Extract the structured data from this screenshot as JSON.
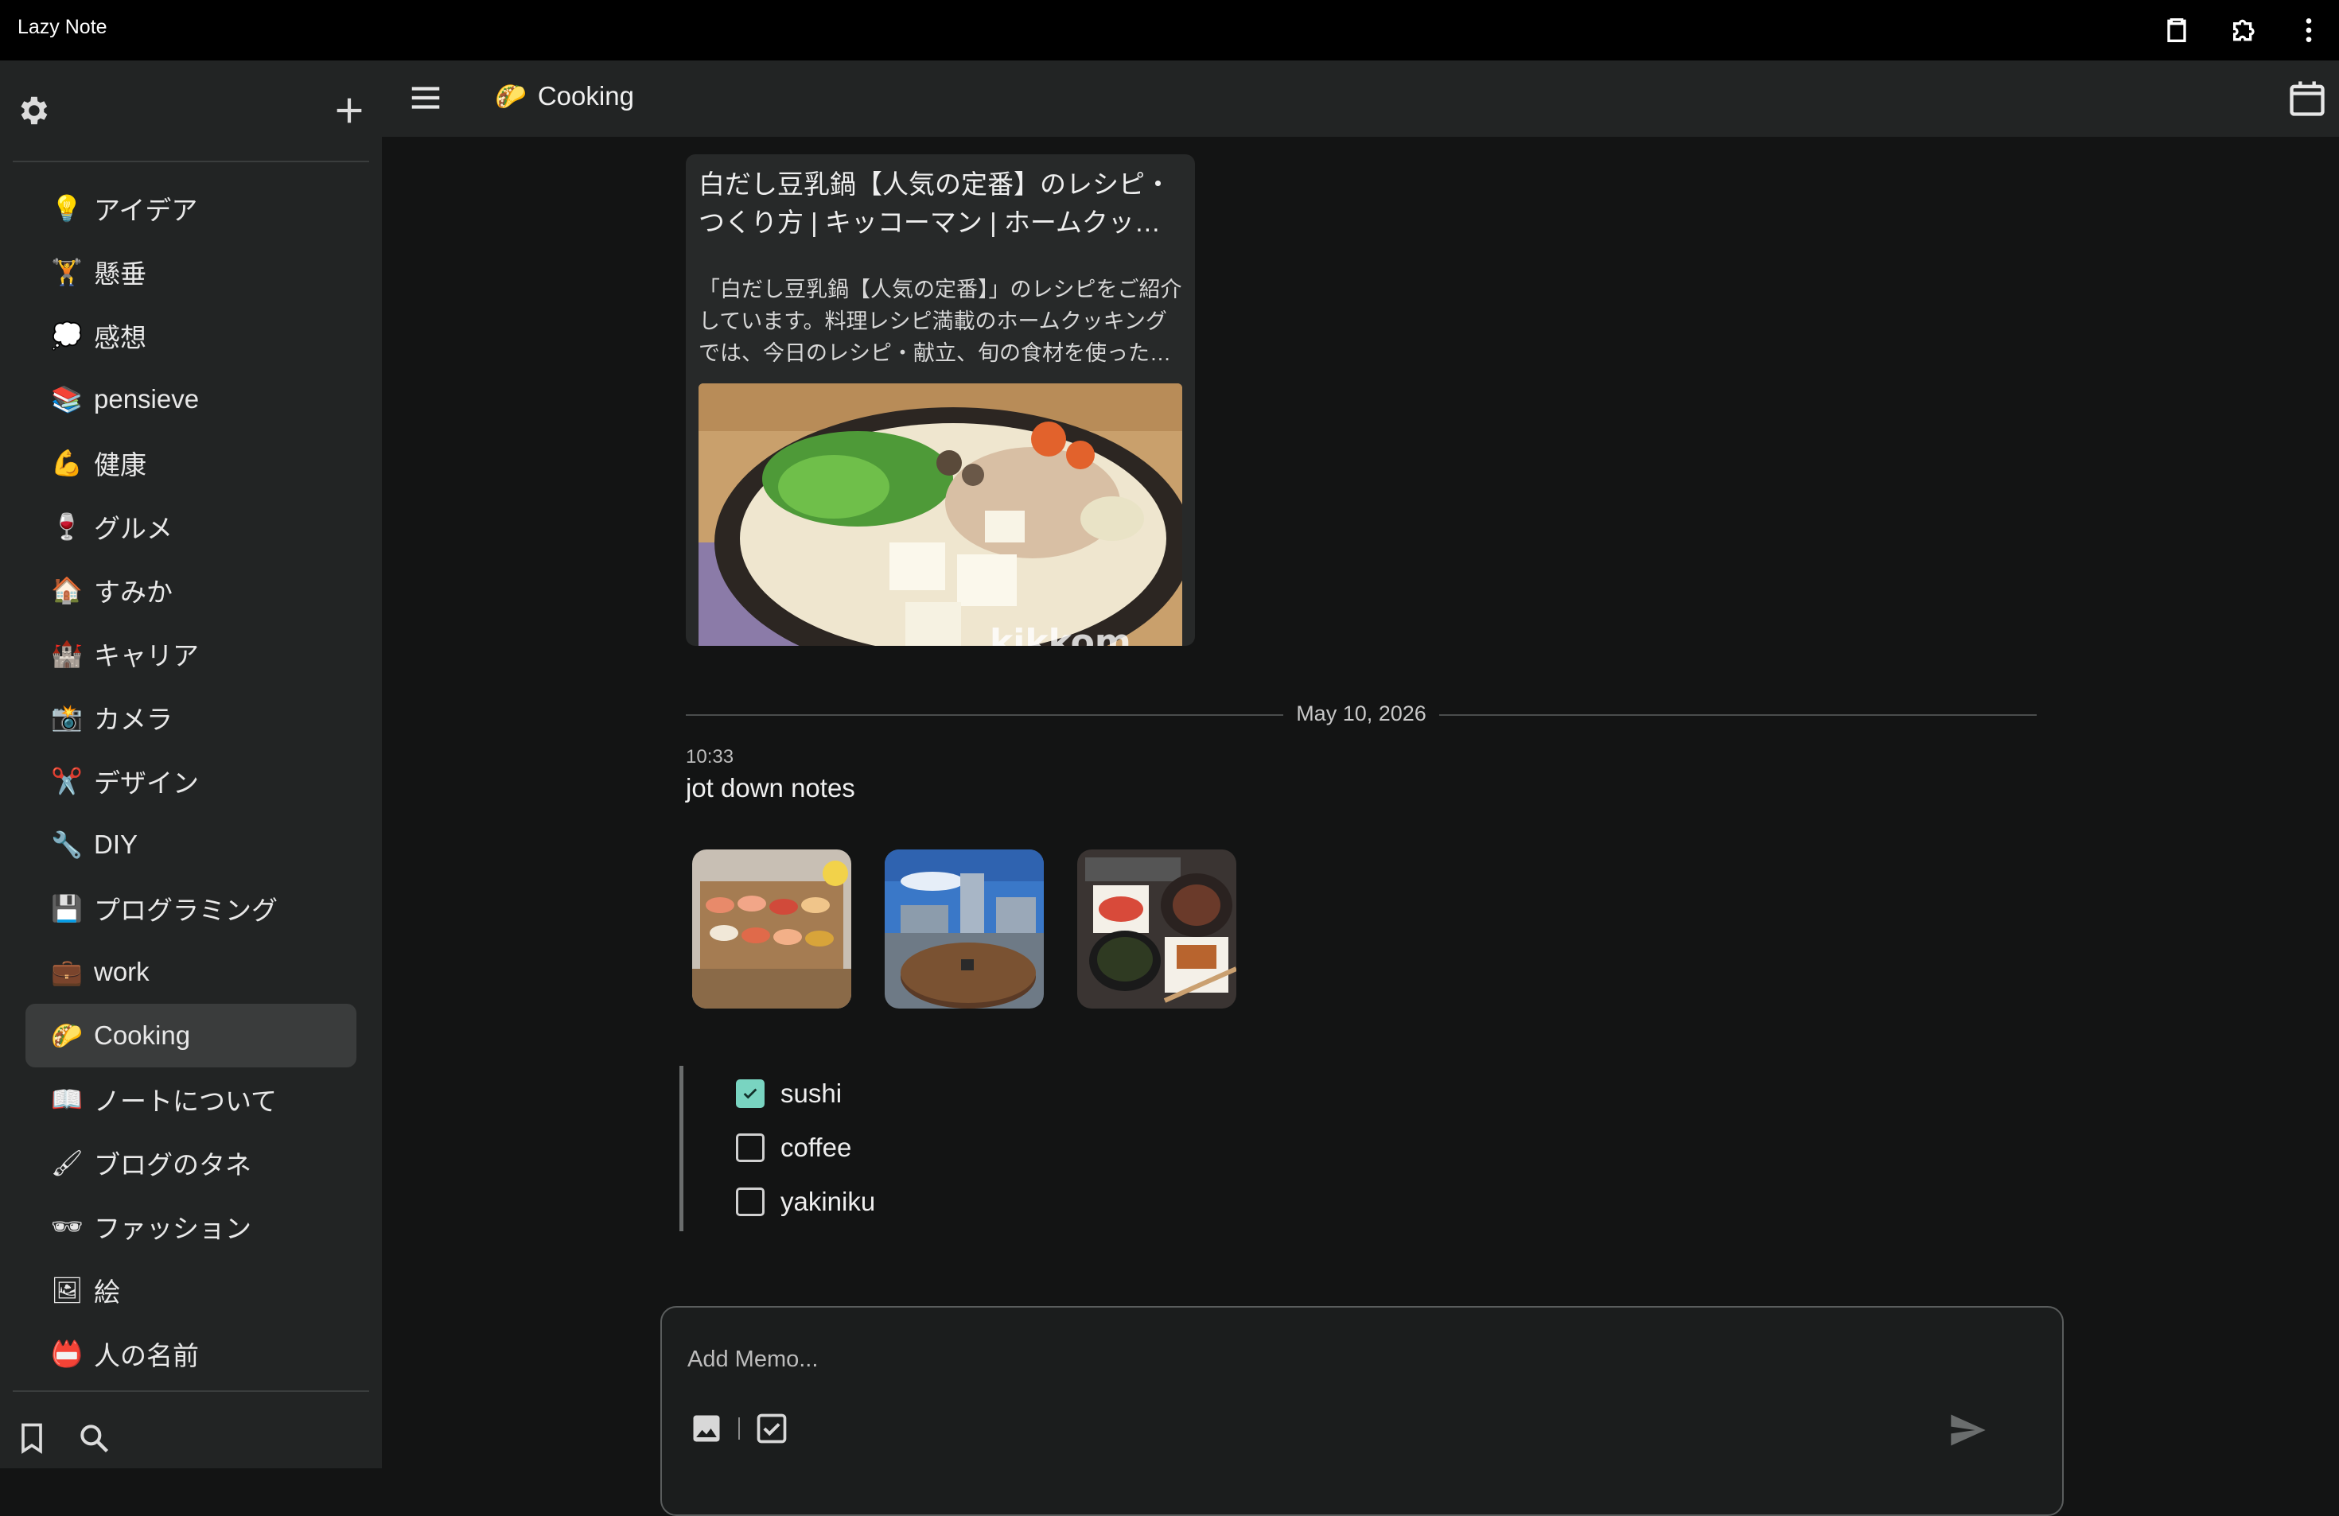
{
  "app": {
    "title": "Lazy Note"
  },
  "sidebar": {
    "items": [
      {
        "emoji": "💡",
        "label": "アイデア"
      },
      {
        "emoji": "🏋",
        "label": "懸垂"
      },
      {
        "emoji": "💭",
        "label": "感想"
      },
      {
        "emoji": "📚",
        "label": "pensieve"
      },
      {
        "emoji": "💪",
        "label": "健康"
      },
      {
        "emoji": "🍷",
        "label": "グルメ"
      },
      {
        "emoji": "🏠",
        "label": "すみか"
      },
      {
        "emoji": "🏰",
        "label": "キャリア"
      },
      {
        "emoji": "📸",
        "label": "カメラ"
      },
      {
        "emoji": "✂️",
        "label": "デザイン"
      },
      {
        "emoji": "🔧",
        "label": "DIY"
      },
      {
        "emoji": "💾",
        "label": "プログラミング"
      },
      {
        "emoji": "💼",
        "label": "work"
      },
      {
        "emoji": "🌮",
        "label": "Cooking",
        "active": true
      },
      {
        "emoji": "📖",
        "label": "ノートについて"
      },
      {
        "emoji": "🖌",
        "label": "ブログのタネ"
      },
      {
        "emoji": "🕶",
        "label": "ファッション"
      },
      {
        "emoji": "🖼",
        "label": "絵"
      },
      {
        "emoji": "📛",
        "label": "人の名前"
      }
    ]
  },
  "header": {
    "emoji": "🌮",
    "title": "Cooking"
  },
  "link_card": {
    "title": "白だし豆乳鍋【人気の定番】のレシピ・つくり方 | キッコーマン | ホームクッキング",
    "description": "「白だし豆乳鍋【人気の定番】」のレシピをご紹介しています。料理レシピ満載のホームクッキングでは、今日のレシピ・献立、旬の食材を使ったレシピをご紹介しています。",
    "image_watermark": "kikkom"
  },
  "date_separator": "May 10, 2026",
  "memo": {
    "time": "10:33",
    "text": "jot down notes",
    "checklist": [
      {
        "label": "sushi",
        "checked": true
      },
      {
        "label": "coffee",
        "checked": false
      },
      {
        "label": "yakiniku",
        "checked": false
      }
    ]
  },
  "composer": {
    "placeholder": "Add Memo..."
  },
  "colors": {
    "accent": "#79d4c1",
    "background": "#131414",
    "panel": "#222424"
  }
}
